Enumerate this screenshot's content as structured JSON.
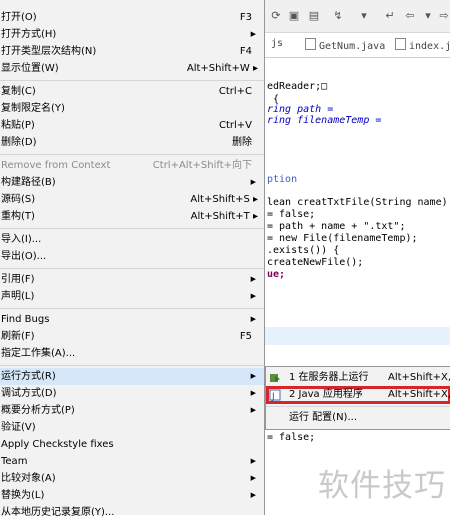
{
  "colors": {
    "highlight_box": "#d6262b",
    "menu_bg": "#f2f2f2",
    "selected_bg": "#d5e7f8",
    "watermark": "#c9c9c9"
  },
  "editor": {
    "tabs": [
      {
        "label": "js"
      },
      {
        "label": "GetNum.java"
      },
      {
        "label": "index.jsp"
      }
    ],
    "code": [
      "edReader;□",
      " {",
      "ring path =",
      "ring filenameTemp =",
      "",
      "",
      "",
      "ption",
      "",
      "lean creatTxtFile(String name) thr",
      "= false;",
      "= path + name + \".txt\";",
      "= new File(filenameTemp);",
      ".exists()) {",
      "createNewFile();",
      "ue;",
      "= false;"
    ],
    "watermark": "软件技巧"
  },
  "menu": {
    "items": [
      {
        "label": "打开(O)",
        "shortcut": "F3"
      },
      {
        "label": "打开方式(H)",
        "arrow": "▶"
      },
      {
        "label": "打开类型层次结构(N)",
        "shortcut": "F4"
      },
      {
        "label": "显示位置(W)",
        "shortcut": "Alt+Shift+W ▸"
      },
      {
        "label": "复制(C)",
        "shortcut": "Ctrl+C"
      },
      {
        "label": "复制限定名(Y)"
      },
      {
        "label": "粘贴(P)",
        "shortcut": "Ctrl+V"
      },
      {
        "label": "删除(D)",
        "shortcut": "删除"
      },
      {
        "label": "Remove from Context",
        "shortcut": "Ctrl+Alt+Shift+向下"
      },
      {
        "label": "构建路径(B)",
        "arrow": "▶"
      },
      {
        "label": "源码(S)",
        "shortcut": "Alt+Shift+S ▸"
      },
      {
        "label": "重构(T)",
        "shortcut": "Alt+Shift+T ▸"
      },
      {
        "label": "导入(I)..."
      },
      {
        "label": "导出(O)..."
      },
      {
        "label": "引用(F)",
        "arrow": "▶"
      },
      {
        "label": "声明(L)",
        "arrow": "▶"
      },
      {
        "label": "Find Bugs",
        "arrow": "▶"
      },
      {
        "label": "刷新(F)",
        "shortcut": "F5"
      },
      {
        "label": "指定工作集(A)..."
      },
      {
        "label": "运行方式(R)",
        "arrow": "▶"
      },
      {
        "label": "调试方式(D)",
        "arrow": "▶"
      },
      {
        "label": "概要分析方式(P)",
        "arrow": "▶"
      },
      {
        "label": "验证(V)"
      },
      {
        "label": "Apply Checkstyle fixes"
      },
      {
        "label": "Team",
        "arrow": "▶"
      },
      {
        "label": "比较对象(A)",
        "arrow": "▶"
      },
      {
        "label": "替换为(L)",
        "arrow": "▶"
      },
      {
        "label": "从本地历史记录复原(Y)..."
      }
    ]
  },
  "submenu": {
    "items": [
      {
        "label": "1 在服务器上运行",
        "shortcut": "Alt+Shift+X, R"
      },
      {
        "label": "2 Java 应用程序",
        "shortcut": "Alt+Shift+X, J"
      },
      {
        "label": "运行 配置(N)..."
      }
    ]
  }
}
